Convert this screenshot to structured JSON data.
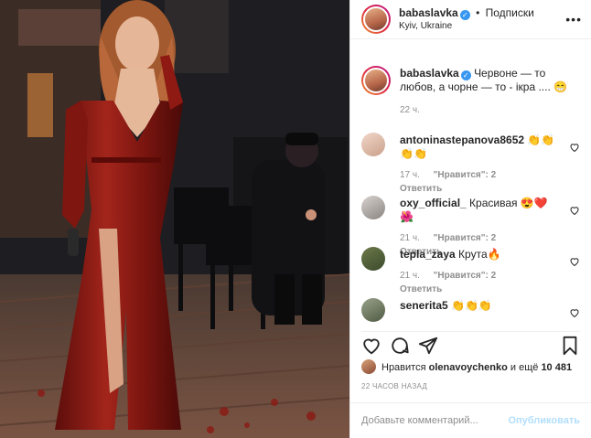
{
  "header": {
    "username": "babaslavka",
    "separator": "•",
    "follow_label": "Подписки",
    "location": "Kyiv, Ukraine",
    "more": "•••"
  },
  "caption": {
    "username": "babaslavka",
    "text": "Червоне — то любов, а чорне — то - ікра .... 😁",
    "time": "22 ч."
  },
  "comments": [
    {
      "username": "antoninastepanova8652",
      "text": "👏👏👏👏",
      "time": "17 ч.",
      "likes": "\"Нравится\": 2",
      "reply": "Ответить"
    },
    {
      "username": "oxy_official_",
      "text": "Красивая 😍❤️🌺",
      "time": "21 ч.",
      "likes": "\"Нравится\": 2",
      "reply": "Ответить"
    },
    {
      "username": "tepla_zaya",
      "text": "Крута🔥",
      "time": "21 ч.",
      "likes": "\"Нравится\": 2",
      "reply": "Ответить"
    },
    {
      "username": "senerita5",
      "text": "👏👏👏",
      "time": "",
      "likes": "",
      "reply": ""
    }
  ],
  "likes_line": {
    "prefix": "Нравится",
    "user": "olenavoychenko",
    "middle": "и ещё",
    "count": "10 481"
  },
  "posted_ago": "22 ЧАСОВ НАЗАД",
  "add_comment": {
    "placeholder": "Добавьте комментарий...",
    "publish": "Опубликовать"
  },
  "colors": {
    "link_blue": "#3897f0",
    "publish_disabled": "#b2dffc",
    "meta_gray": "#8e8e8e",
    "dress_red": "#8b1a14"
  }
}
